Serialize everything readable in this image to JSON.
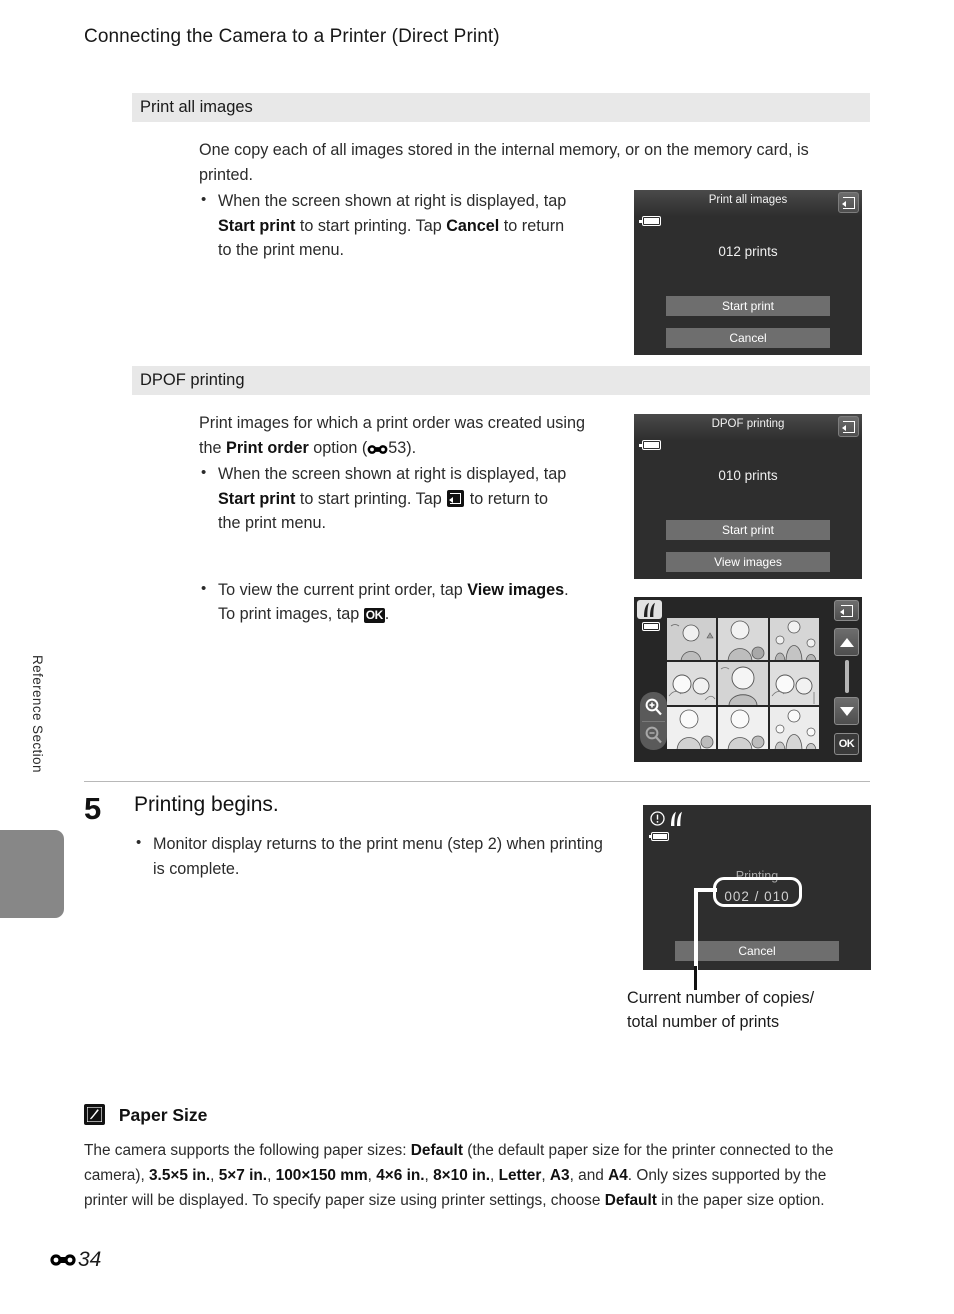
{
  "page": {
    "title": "Connecting the Camera to a Printer (Direct Print)",
    "side_label": "Reference Section",
    "page_number": "34",
    "page_number_symbol": "E-reference-icon"
  },
  "sections": [
    {
      "heading": "Print all images",
      "paragraph": "One copy each of all images stored in the internal memory, or on the memory card, is printed.",
      "bullets": [
        {
          "part1": "When the screen shown at right is displayed, tap ",
          "bold1": "Start print",
          "part2": " to start printing. Tap ",
          "bold2": "Cancel",
          "part3": " to return to the print menu."
        }
      ],
      "screen": {
        "title": "Print all images",
        "count": "012 prints",
        "button1": "Start print",
        "button2": "Cancel",
        "back_icon": "back-arrow-icon",
        "battery_icon": "battery-icon"
      }
    },
    {
      "heading": "DPOF printing",
      "paragraph_part1": "Print images for which a print order was created using the ",
      "paragraph_bold": "Print order",
      "paragraph_part2": " option (",
      "paragraph_ref": "53",
      "paragraph_part3": ").",
      "bullets": [
        {
          "part1": "When the screen shown at right is displayed, tap ",
          "bold1": "Start print",
          "part2": " to start printing. Tap ",
          "icon": "back-arrow-icon",
          "part3": " to return to the print menu."
        },
        {
          "part1": "To view the current print order, tap ",
          "bold1": "View images",
          "part2": ". To print images, tap ",
          "icon": "ok-icon",
          "ok_label": "OK",
          "part3": "."
        }
      ],
      "screen": {
        "title": "DPOF printing",
        "count": "010 prints",
        "button1": "Start print",
        "button2": "View images",
        "back_icon": "back-arrow-icon",
        "battery_icon": "battery-icon"
      },
      "grid_screen": {
        "printer_icon": "printer-icon",
        "battery_icon": "battery-icon",
        "zoom_in_icon": "zoom-in-icon",
        "zoom_out_icon": "zoom-out-icon",
        "back_icon": "back-arrow-icon",
        "scroll_up_icon": "scroll-up-icon",
        "scroll_down_icon": "scroll-down-icon",
        "ok_label": "OK",
        "thumbnail_count": 9
      }
    }
  ],
  "step": {
    "number": "5",
    "title": "Printing begins.",
    "bullets": [
      "Monitor display returns to the print menu (step 2) when printing is complete."
    ],
    "screen": {
      "status_label": "Printing",
      "counter": "002  /  010",
      "cancel_label": "Cancel",
      "warning_icon": "warning-icon",
      "printer_icon": "printer-icon",
      "battery_icon": "battery-icon"
    },
    "caption_line1": "Current number of copies/",
    "caption_line2": "total number of prints"
  },
  "note": {
    "icon": "pencil-note-icon",
    "heading": "Paper Size",
    "text_part1": "The camera supports the following paper sizes: ",
    "bold1": "Default",
    "text_part2": " (the default paper size for the printer connected to the camera), ",
    "bold2": "3.5×5 in.",
    "text_part3": ", ",
    "bold3": "5×7 in.",
    "text_part4": ", ",
    "bold4": "100×150 mm",
    "text_part5": ", ",
    "bold5": "4×6 in.",
    "text_part6": ", ",
    "bold6": "8×10 in.",
    "text_part7": ", ",
    "bold7": "Letter",
    "text_part8": ", ",
    "bold8": "A3",
    "text_part9": ", and ",
    "bold9": "A4",
    "text_part10": ". Only sizes supported by the printer will be displayed. To specify paper size using printer settings, choose ",
    "bold10": "Default",
    "text_part11": " in the paper size option."
  }
}
